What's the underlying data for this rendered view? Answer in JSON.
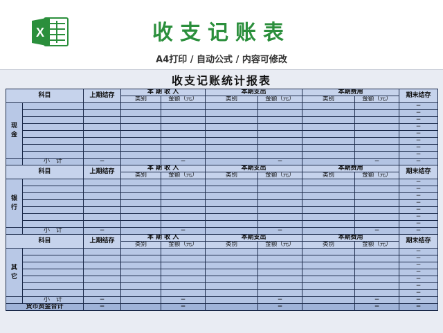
{
  "banner": {
    "title": "收支记账表",
    "subtitle": "A4打印 / 自动公式 / 内容可修改"
  },
  "sheet": {
    "title": "收支记账统计报表",
    "headers": {
      "subject": "科目",
      "prev_balance": "上期结存",
      "income": "本 期 收 入",
      "expense": "本期支出",
      "cost": "本期费用",
      "end_balance": "期末结存",
      "type": "类别",
      "amount": "金额（元）"
    },
    "sections": [
      {
        "name": "现金",
        "name_v": "现\n金"
      },
      {
        "name": "银行",
        "name_v": "银\n行"
      },
      {
        "name": "其它",
        "name_v": "其\n它"
      }
    ],
    "subtotal_label": "小　计",
    "grand_total_label": "货币资金合计",
    "dash": "−"
  },
  "colors": {
    "accent_green": "#2b8f3c",
    "cell_blue": "#b8c8e6",
    "border": "#1b2a4a"
  }
}
